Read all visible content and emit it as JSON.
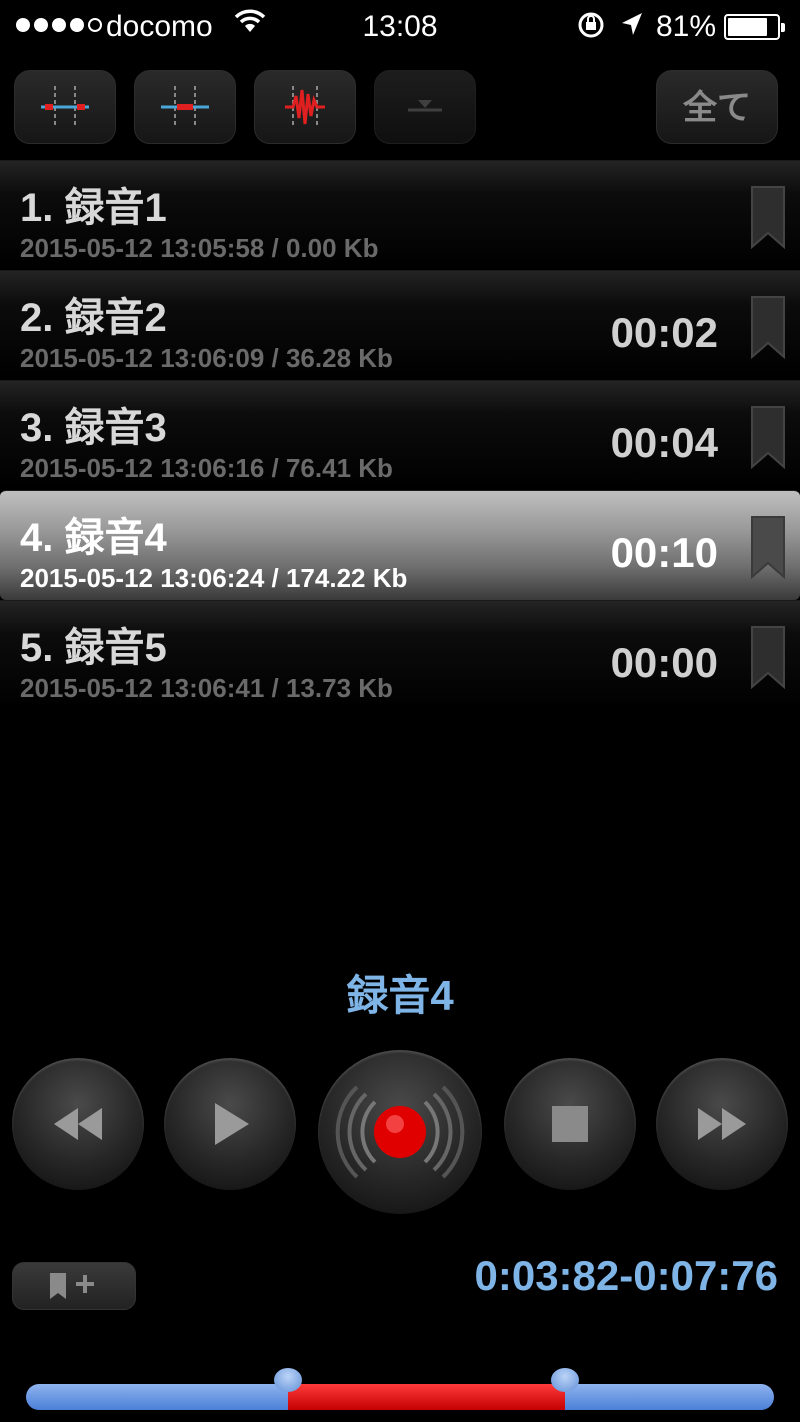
{
  "status_bar": {
    "carrier": "docomo",
    "time": "13:08",
    "battery_percent": "81%",
    "battery_level": 0.81,
    "signal_bars": 4,
    "signal_max": 5
  },
  "toolbar": {
    "buttons": [
      "split-icon",
      "trim-icon",
      "waveform-icon",
      "insert-icon"
    ],
    "all_label": "全て"
  },
  "recordings": [
    {
      "name": "1. 録音1",
      "meta": "2015-05-12 13:05:58 / 0.00 Kb",
      "duration": "",
      "selected": false
    },
    {
      "name": "2. 録音2",
      "meta": "2015-05-12 13:06:09 / 36.28 Kb",
      "duration": "00:02",
      "selected": false
    },
    {
      "name": "3. 録音3",
      "meta": "2015-05-12 13:06:16 / 76.41 Kb",
      "duration": "00:04",
      "selected": false
    },
    {
      "name": "4. 録音4",
      "meta": "2015-05-12 13:06:24 / 174.22 Kb",
      "duration": "00:10",
      "selected": true
    },
    {
      "name": "5. 録音5",
      "meta": "2015-05-12 13:06:41 / 13.73 Kb",
      "duration": "00:00",
      "selected": false
    }
  ],
  "now_playing": {
    "title": "録音4"
  },
  "transport": [
    "rewind-icon",
    "play-icon",
    "record-icon",
    "stop-icon",
    "fast-forward-icon"
  ],
  "playback": {
    "range": "0:03:82-0:07:76",
    "selection_start": 0.35,
    "selection_end": 0.72
  },
  "colors": {
    "accent_blue": "#7fb4e6",
    "record_red": "#e00000"
  }
}
